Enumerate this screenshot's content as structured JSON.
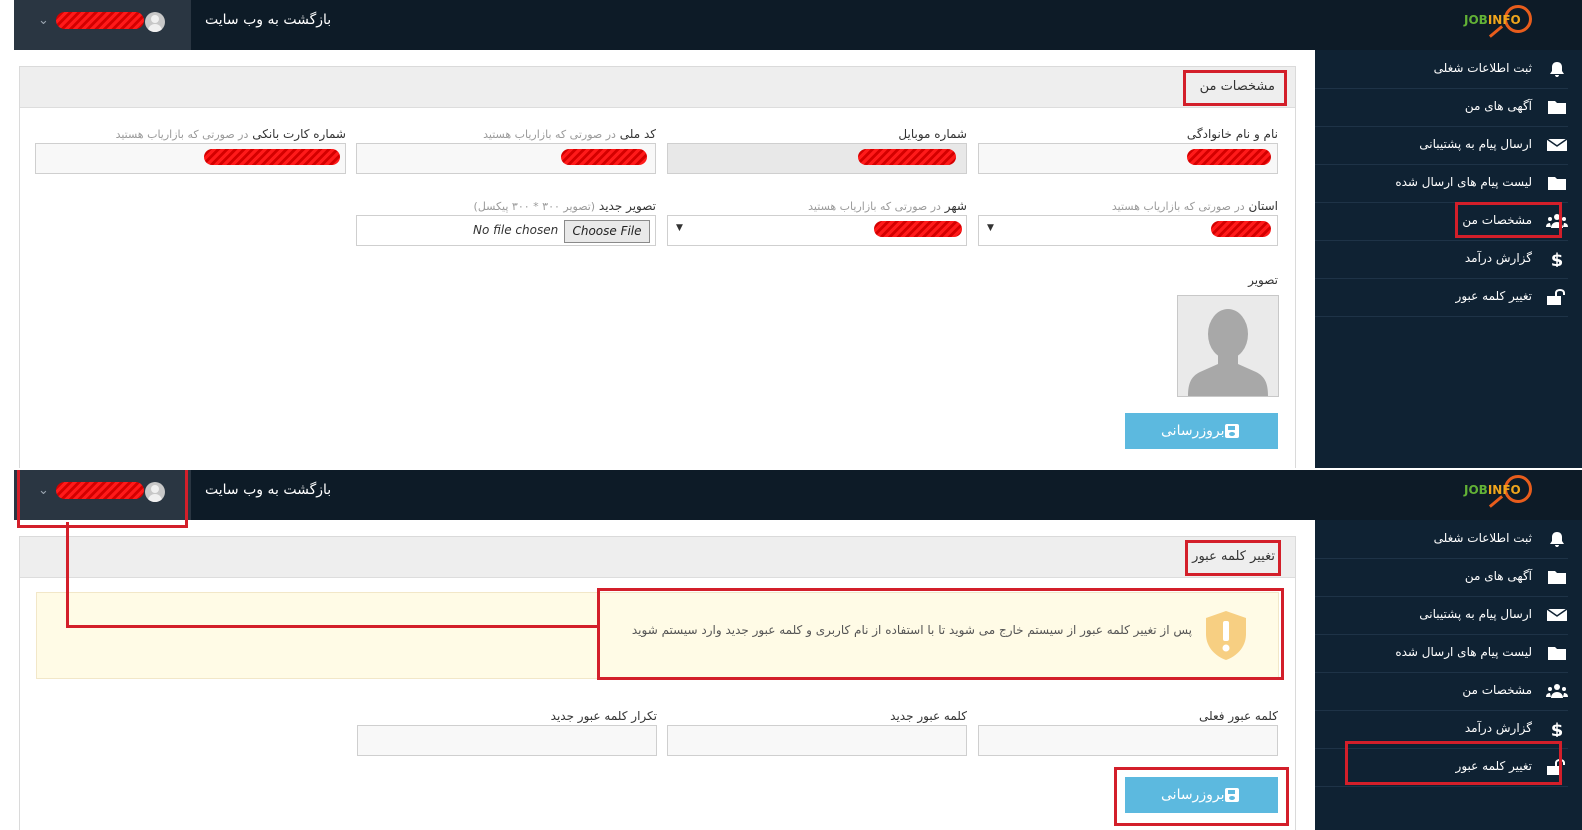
{
  "brand": {
    "logo_job": "JOB",
    "logo_info": "INFO"
  },
  "header": {
    "back_label": "بازگشت به وب سایت"
  },
  "sidebar": {
    "items": [
      {
        "label": "ثبت اطلاعات شغلی",
        "icon": "bell-icon"
      },
      {
        "label": "آگهی های من",
        "icon": "folder-icon"
      },
      {
        "label": "ارسال پیام به پشتیبانی",
        "icon": "envelope-icon"
      },
      {
        "label": "لیست پیام های ارسال شده",
        "icon": "folder-icon"
      },
      {
        "label": "مشخصات من",
        "icon": "users-icon"
      },
      {
        "label": "گزارش درآمد",
        "icon": "dollar-icon"
      },
      {
        "label": "تغییر کلمه عبور",
        "icon": "unlock-icon"
      }
    ]
  },
  "profile": {
    "title": "مشخصات من",
    "fields": {
      "full_name": {
        "label": "نام و نام خانوادگی"
      },
      "mobile": {
        "label": "شماره موبایل"
      },
      "national_code": {
        "label": "کد ملی",
        "hint": "در صورتی که بازاریاب هستید"
      },
      "bank_card": {
        "label": "شماره کارت بانکی",
        "hint": "در صورتی که بازاریاب هستید"
      },
      "province": {
        "label": "استان",
        "hint": "در صورتی که بازاریاب هستید"
      },
      "city": {
        "label": "شهر",
        "hint": "در صورتی که بازاریاب هستید"
      },
      "new_image": {
        "label": "تصویر جدید",
        "hint": "(تصویر ۳۰۰ * ۳۰۰ پیکسل)",
        "button": "Choose File",
        "status": "No file chosen"
      }
    },
    "image_label": "تصویر",
    "update_label": "بروزرسانی"
  },
  "password": {
    "title": "تغییر کلمه عبور",
    "alert": "پس از تغییر کلمه عبور از سیستم خارج می شوید تا با استفاده از نام کاربری و کلمه عبور جدید وارد سیستم شوید",
    "current_label": "کلمه عبور فعلی",
    "new_label": "کلمه عبور جدید",
    "repeat_label": "تکرار کلمه عبور جدید",
    "update_label": "بروزرسانی"
  },
  "colors": {
    "header_bg": "#0d1b27",
    "sidebar_bg": "#0f2233",
    "button": "#5cb9df",
    "highlight": "#d31f2a",
    "alert_bg": "#fffbe6"
  }
}
